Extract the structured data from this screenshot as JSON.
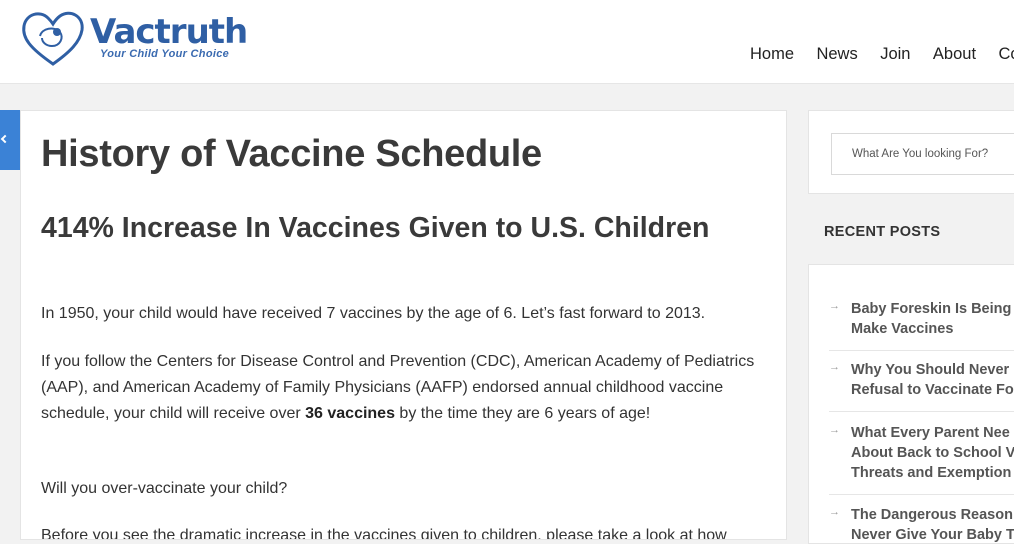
{
  "header": {
    "brand": "Vactruth",
    "tagline": "Your Child Your Choice",
    "nav": [
      "Home",
      "News",
      "Join",
      "About",
      "Co"
    ]
  },
  "article": {
    "title": "History of Vaccine Schedule",
    "subheading": "414% Increase In Vaccines Given to U.S. Children",
    "p1": "In 1950, your child would have received 7 vaccines by the age of 6. Let’s fast forward to 2013.",
    "p2_before": "If you follow the Centers for Disease Control and Prevention (CDC), American Academy of Pediatrics (AAP), and American Academy of Family Physicians (AAFP) endorsed annual childhood vaccine schedule, your child will receive over ",
    "p2_bold": "36 vaccines",
    "p2_after": " by the time they are 6 years of age!",
    "p3": "Will you over-vaccinate your child?",
    "p4": "Before you see the dramatic increase in the vaccines given to children, please take a look at how"
  },
  "sidebar": {
    "search_placeholder": "What Are You looking For?",
    "recent_heading": "RECENT POSTS",
    "posts": [
      "Baby Foreskin Is Being\nMake Vaccines",
      "Why You Should Never\nRefusal to Vaccinate Fo",
      "What Every Parent Nee\nAbout Back to School V\nThreats and Exemption",
      "The Dangerous Reason\nNever Give Your Baby T"
    ]
  },
  "colors": {
    "brand": "#2f5fa4",
    "accent_tab": "#3b82d6"
  }
}
